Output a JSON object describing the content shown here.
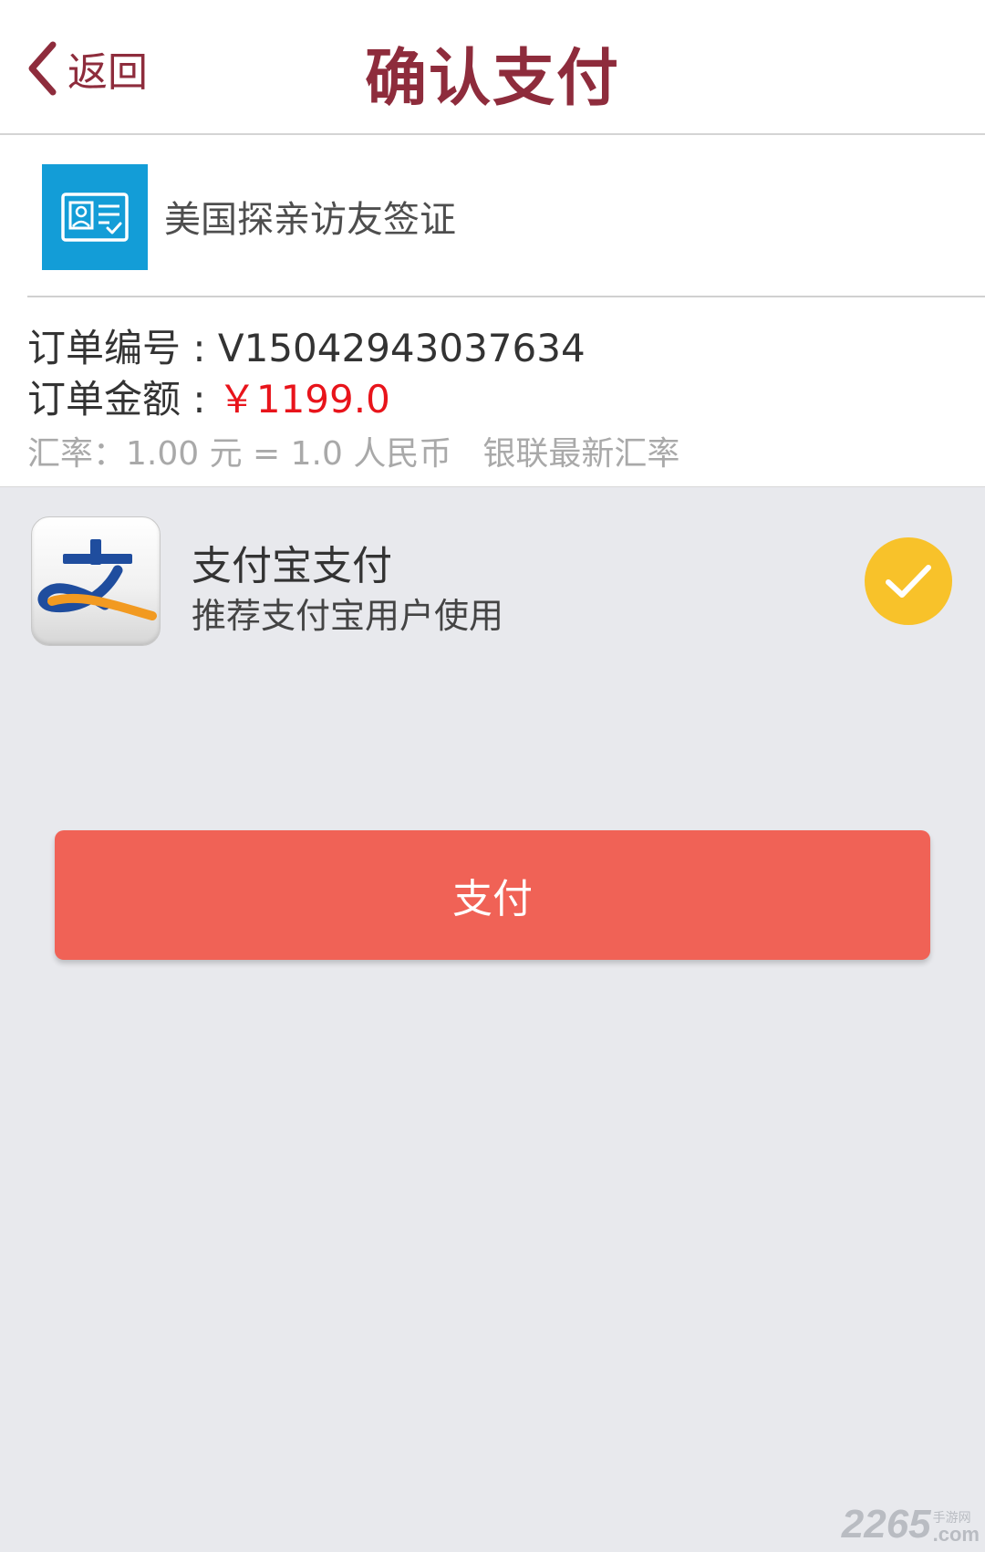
{
  "header": {
    "back_label": "返回",
    "title": "确认支付"
  },
  "order": {
    "product_name": "美国探亲访友签证",
    "order_no_label": "订单编号 : ",
    "order_no_value": "V15042943037634",
    "amount_label": "订单金额 : ",
    "amount_value": "￥1199.0",
    "exchange_rate": "汇率：1.00 元 = 1.0 人民币",
    "exchange_source": "银联最新汇率"
  },
  "payment": {
    "method_title": "支付宝支付",
    "method_subtitle": "推荐支付宝用户使用",
    "selected": true
  },
  "pay_button": {
    "label": "支付"
  },
  "watermark": {
    "number": "2265",
    "site_cn": "手游网",
    "suffix": ".com"
  },
  "colors": {
    "brand": "#8e2c3c",
    "amount": "#e8141b",
    "pay_button": "#f06256",
    "check": "#f8c22a",
    "product_icon_bg": "#139dd7",
    "background": "#e8e9ed"
  },
  "icons": {
    "back": "chevron-left-icon",
    "product": "id-card-icon",
    "payment_logo": "alipay-logo",
    "selected": "checkmark-icon"
  }
}
